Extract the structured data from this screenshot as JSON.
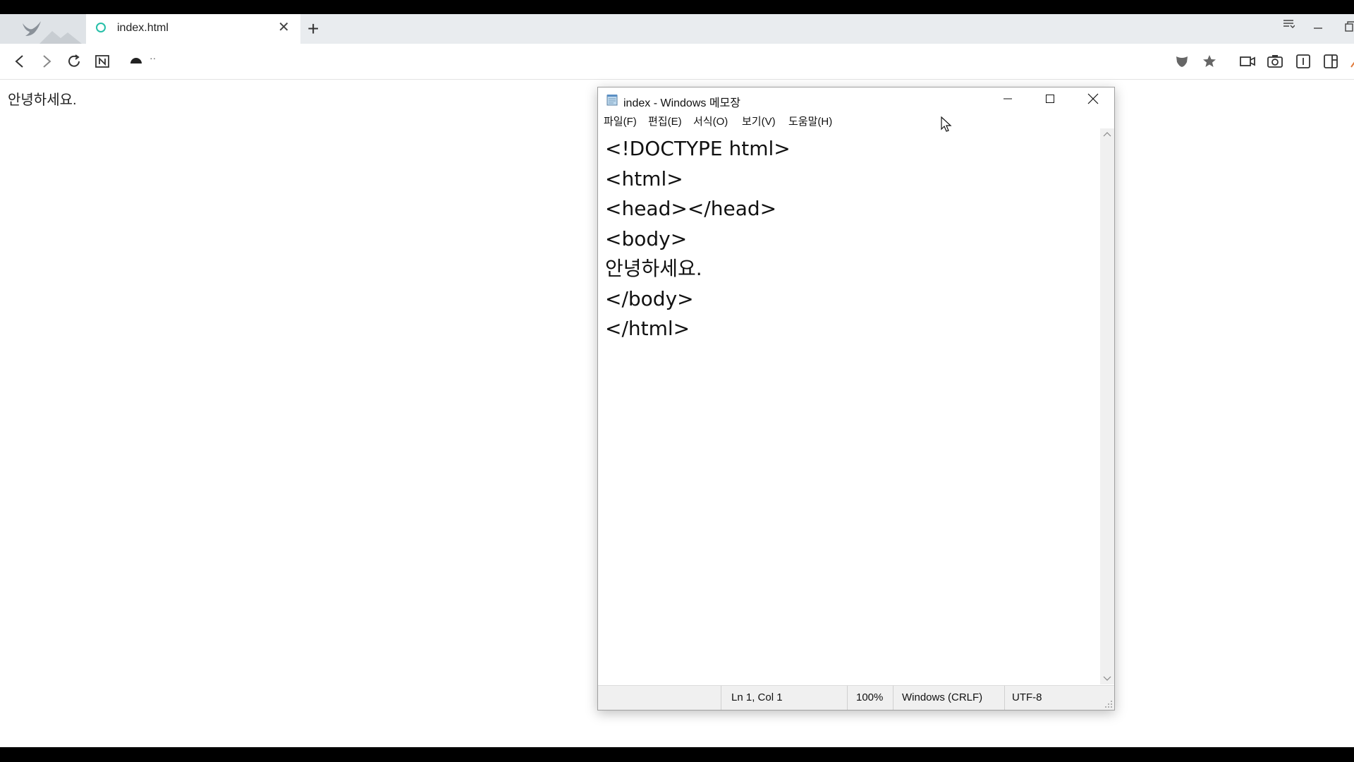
{
  "browser": {
    "tab": {
      "title": "index.html",
      "close": "✕"
    },
    "newtab": "+",
    "address": "··",
    "page_text": "안녕하세요."
  },
  "notepad": {
    "title": "index - Windows 메모장",
    "menu": [
      "파일(F)",
      "편집(E)",
      "서식(O)",
      "보기(V)",
      "도움말(H)"
    ],
    "content": "<!DOCTYPE html>\n<html>\n<head></head>\n<body>\n안녕하세요.\n</body>\n</html>",
    "status": {
      "position": "Ln 1, Col 1",
      "zoom": "100%",
      "line_ending": "Windows (CRLF)",
      "encoding": "UTF-8"
    }
  },
  "colors": {
    "accent": "#26bfa8",
    "chrome": "#e9ecef",
    "statusbar": "#f0f0f0"
  }
}
